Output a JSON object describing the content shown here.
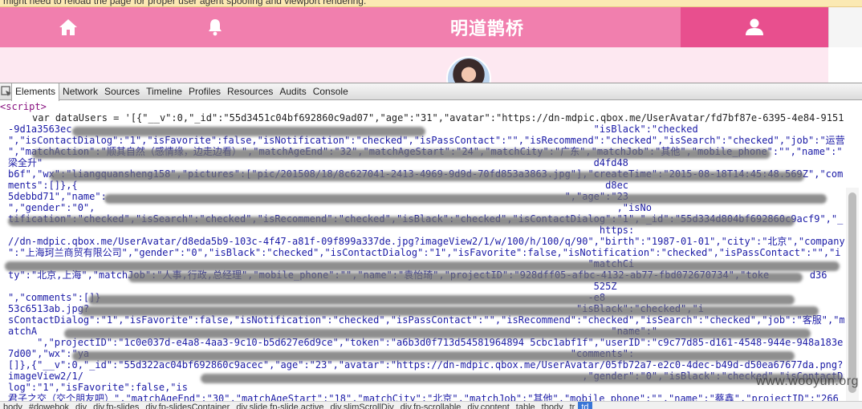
{
  "browser_warning": "might need to reload the page for proper user agent spoofing and viewport rendering.",
  "app": {
    "title": "明道鹊桥",
    "nav": [
      {
        "icon": "home-icon"
      },
      {
        "icon": "bell-icon"
      },
      {
        "icon": "user-icon"
      }
    ],
    "accent": "#f17fae",
    "active_tab": "#e84f8e"
  },
  "devtools": {
    "tabs": [
      "Elements",
      "Network",
      "Sources",
      "Timeline",
      "Profiles",
      "Resources",
      "Audits",
      "Console"
    ],
    "active_tab": "Elements",
    "code_lines": [
      "<script>",
      "var dataUsers = '[{\"__v\":0,\"_id\":\"55d3451c04bf692860c9ad07\",\"age\":\"31\",\"avatar\":\"https://dn-mdpic.qbox.me/UserAvatar/fd7bf87e-6395-4e84-9151",
      "-9d1a3563ec                                                                                          \"isBlack\":\"checked",
      "\",\"isContactDialog\":\"1\",\"isFavorite\":false,\"isNotification\":\"checked\",\"isPassContact\":\"\",\"isRecommend\":\"checked\",\"isSearch\":\"checked\",\"job\":\"运营",
      "\",\"matchAction\":\"顺其自然（感情缘，边走边看）\",\"matchAgeEnd\":\"32\",\"matchAgeStart\":\"24\",\"matchCity\":\"广东\",\"matchJob\":\"其他\",\"mobile_phone\":\"\",\"name\":\"",
      "梁全升\"                                                                                               d4fd48",
      "b6f\",\"wx\":\"liangquansheng158\",\"pictures\":[\"pic/201508/18/8c627041-2413-4969-9d9d-70fd853a3863.jpg\"],\"createTime\":\"2015-08-18T14:45:48.569Z\",\"com",
      "ments\":[]},{                                                                                           d8ec",
      "5debbd71\",\"name\":                                                                               \",\"age\":\"23",
      "\",\"gender\":\"0\",                                                                                          ,\"isNo",
      "tification\":\"checked\",\"isSearch\":\"checked\",\"isRecommend\":\"checked\",\"isBlack\":\"checked\",\"isContactDialog\":\"1\",\"_id\":\"55d334d804bf692860c9acf9\",\"_",
      "                                                                                                      https:",
      "//dn-mdpic.qbox.me/UserAvatar/d8eda5b9-103c-4f47-a81f-09f899a337de.jpg?imageView2/1/w/100/h/100/q/90\",\"birth\":\"1987-01-01\",\"city\":\"北京\",\"company",
      "\":\"上海珂兰商贸有限公司\",\"gender\":\"0\",\"isBlack\":\"checked\",\"isContactDialog\":\"1\",\"isFavorite\":false,\"isNotification\":\"checked\",\"isPassContact\":\"\",\"i",
      "                                                                                                    \"matchCi",
      "ty\":\"北京,上海\",\"matchJob\":\"人事,行政,总经理\",\"mobile_phone\":\"\",\"name\":\"袁怡琦\",\"projectID\":\"928dff05-afbc-4132-ab77-fbd072670734\",\"toke       d36",
      "                                                                                                     525Z",
      "\",\"comments\":[]}                                                                                    -e8",
      "53c6513ab.jpg?                                                                                    \"isBlack\":\"checked\",\"i",
      "sContactDialog\":\"1\",\"isFavorite\":false,\"isNotification\":\"checked\",\"isPassContact\":\"\",\"isRecommend\":\"checked\",\"isSearch\":\"checked\",\"job\":\"客服\",\"m",
      "atchA                                                                                                   \"name\":\"",
      "     \",\"projectID\":\"1c0e037d-e4a8-4aa3-9c10-b5d627e6d9ce\",\"token\":\"a6b3d0f713d54581964894 5cbc1abf1f\",\"userID\":\"c9c77d85-d161-4548-944e-948a183e",
      "7d00\",\"wx\":\"ya                                                                                   \"comments\":",
      "[]},{\"__v\":0,\"_id\":\"55d322ac04bf692860c9acec\",\"age\":\"23\",\"avatar\":\"https://dn-mdpic.qbox.me/UserAvatar/05fb72a7-e2c0-4dec-b49d-d50ea67677da.png?",
      "imageView2/1/                                                                                      ,\"gender\":\"0\",\"isBlack\":\"checked\",\"isContactDia",
      "log\":\"1\",\"isFavorite\":false,\"is                                                                                      ",
      "君子之交（交个朋友吧）\",\"matchAgeEnd\":\"30\",\"matchAgeStart\":\"18\",\"matchCity\":\"北京\",\"matchJob\":\"其他\",\"mobile_phone\":\"\",\"name\":\"蔡鑫\",\"projectID\":\"266"
    ],
    "breadcrumbs": [
      "body",
      "#dowebok",
      "div",
      "div.fp-slides",
      "div.fp-slidesContainer",
      "div.slide.fp-slide.active",
      "div.slimScrollDiv",
      "div.fp-scrollable",
      "div.content",
      "table",
      "tbody",
      "tr",
      "td"
    ],
    "active_crumb": "td"
  },
  "watermark": "www.wooyun.org"
}
